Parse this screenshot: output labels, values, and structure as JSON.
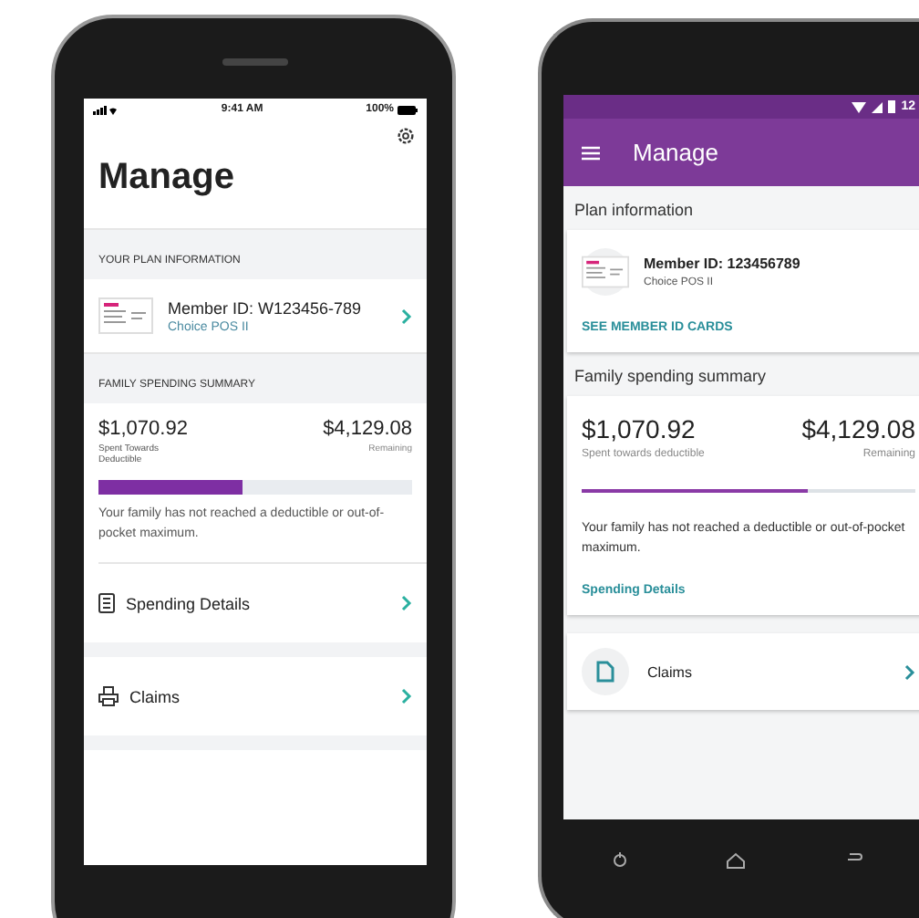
{
  "ios": {
    "status_bar": {
      "time": "9:41 AM",
      "battery": "100%"
    },
    "title": "Manage",
    "plan_section": {
      "heading": "YOUR PLAN INFORMATION",
      "member_id": "Member ID: W123456-789",
      "plan": "Choice POS II"
    },
    "spending_section": {
      "heading": "FAMILY SPENDING SUMMARY",
      "spent": "$1,070.92",
      "spent_label": "Spent Towards Deductible",
      "remaining": "$4,129.08",
      "remaining_label": "Remaining",
      "level": 0.46,
      "message": "Your family has not reached a deductible or out-of-pocket maximum."
    },
    "rows": [
      {
        "kind": "details",
        "label": "Spending Details"
      },
      {
        "kind": "claims",
        "label": "Claims"
      }
    ]
  },
  "android": {
    "status_bar": {
      "time": "12"
    },
    "title": "Manage",
    "plan_section": {
      "heading": "Plan information",
      "member_id": "Member ID: 123456789",
      "plan": "Choice POS II",
      "link": "SEE MEMBER ID CARDS"
    },
    "spending_section": {
      "heading": "Family spending summary",
      "spent": "$1,070.92",
      "spent_label": "Spent towards deductible",
      "remaining": "$4,129.08",
      "remaining_label": "Remaining",
      "level": 0.68,
      "message": "Your family has not reached a deductible or out-of-pocket maximum.",
      "link": "Spending Details"
    },
    "rows": [
      {
        "kind": "claims",
        "label": "Claims"
      }
    ]
  }
}
